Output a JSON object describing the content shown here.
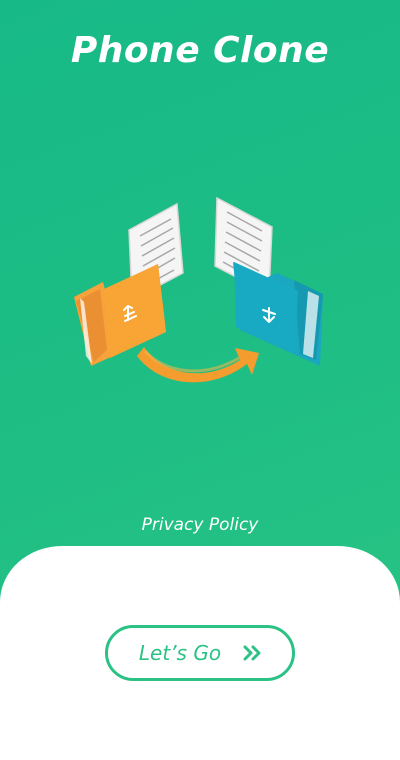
{
  "app": {
    "title": "Phone Clone"
  },
  "illustration": {
    "name": "phone-clone-transfer",
    "icons": [
      "document-icon",
      "folder-upload-icon",
      "folder-download-icon",
      "curved-arrow-icon"
    ]
  },
  "links": {
    "privacy_policy": "Privacy Policy"
  },
  "actions": {
    "go_label": "Let’s Go",
    "go_icon": "double-chevron-right-icon"
  },
  "colors": {
    "background_top": "#17b987",
    "background_bottom": "#2cc685",
    "accent": "#2cc185",
    "orange_folder": "#f7a23a",
    "teal_folder": "#1aa7bf",
    "arrow_orange": "#f49c2e"
  }
}
